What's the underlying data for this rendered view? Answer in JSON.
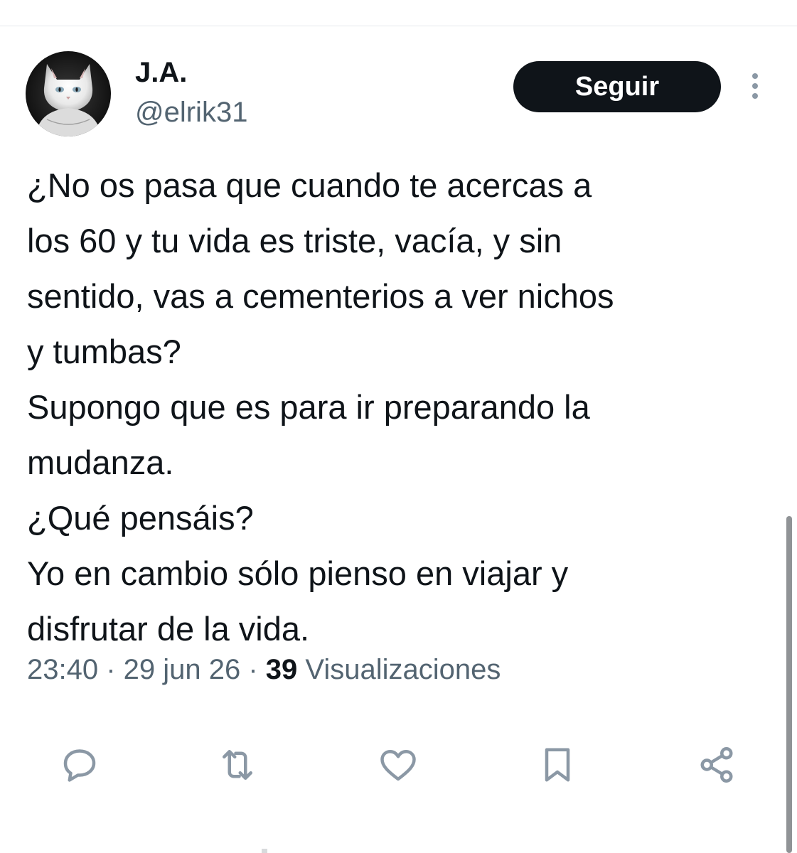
{
  "author": {
    "display_name": "J.A.",
    "handle": "@elrik31",
    "avatar_icon": "white-cat-avatar"
  },
  "follow_button": {
    "label": "Seguir"
  },
  "more_button": {
    "icon": "more-vertical-icon"
  },
  "tweet": {
    "lines": [
      "¿No os pasa que cuando te acercas a",
      "los 60 y tu vida es triste, vacía, y sin",
      "sentido, vas a cementerios a ver nichos",
      "y tumbas?",
      "Supongo que es para ir preparando la",
      "mudanza.",
      "¿Qué pensáis?",
      "Yo en cambio sólo pienso en viajar y",
      "disfrutar de la vida."
    ]
  },
  "meta": {
    "time": "23:40",
    "separator": " · ",
    "date": "29 jun 26",
    "views_count": "39",
    "views_label": " Visualizaciones"
  },
  "actions": [
    {
      "icon": "reply-icon"
    },
    {
      "icon": "retweet-icon"
    },
    {
      "icon": "like-icon"
    },
    {
      "icon": "bookmark-icon"
    },
    {
      "icon": "share-icon"
    }
  ],
  "colors": {
    "text_primary": "#0f1419",
    "text_secondary": "#536471",
    "button_bg": "#0f1419",
    "button_text": "#ffffff",
    "icon_gray": "#8b98a5",
    "divider": "#e6e9ec"
  }
}
